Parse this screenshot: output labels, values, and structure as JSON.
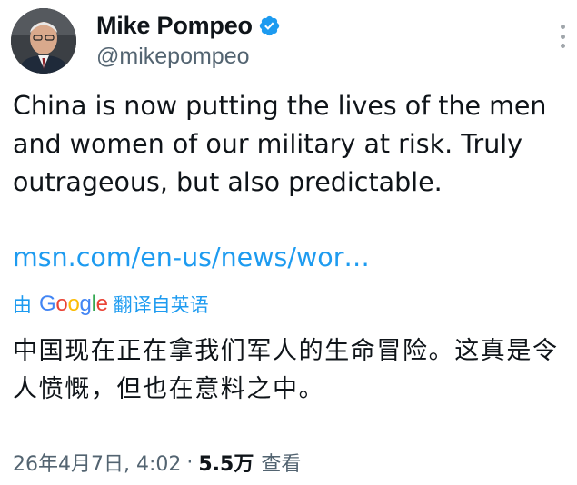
{
  "author": {
    "display_name": "Mike Pompeo",
    "handle": "@mikepompeo",
    "verified": true,
    "verified_color": "#1d9bf0"
  },
  "tweet": {
    "text": "China is now putting the lives of the men\nand women of our military at risk. Truly\noutrageous, but also predictable.",
    "link": "msn.com/en-us/news/wor…",
    "link_color": "#1d9bf0"
  },
  "translation": {
    "by_label": "由",
    "provider": "Google",
    "action_label": "翻译自英语",
    "text": "中国现在正在拿我们军人的生命冒险。这真是令人愤慨，但也在意料之中。"
  },
  "meta": {
    "timestamp": "26年4月7日, 4:02",
    "separator": "·",
    "views_count": "5.5万",
    "views_label": "查看"
  },
  "icons": {
    "verified": "verified-badge-icon",
    "more": "more-options-icon"
  }
}
